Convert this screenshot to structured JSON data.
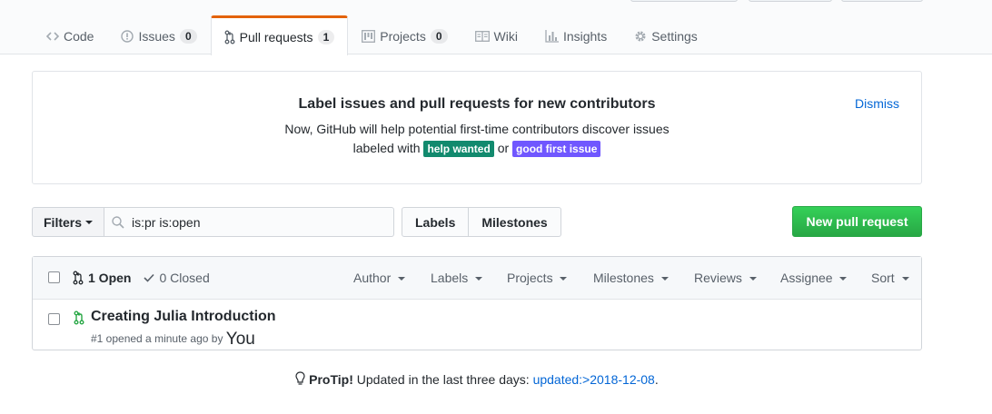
{
  "tabs": [
    {
      "label": "Code",
      "icon": "code-icon"
    },
    {
      "label": "Issues",
      "icon": "issue-opened-icon",
      "count": "0"
    },
    {
      "label": "Pull requests",
      "icon": "git-pull-request-icon",
      "count": "1",
      "selected": true
    },
    {
      "label": "Projects",
      "icon": "project-icon",
      "count": "0"
    },
    {
      "label": "Wiki",
      "icon": "book-icon"
    },
    {
      "label": "Insights",
      "icon": "graph-icon"
    },
    {
      "label": "Settings",
      "icon": "gear-icon"
    }
  ],
  "notice": {
    "title": "Label issues and pull requests for new contributors",
    "line1": "Now, GitHub will help potential first-time contributors discover issues",
    "line2_prefix": "labeled with",
    "label_help_wanted": "help wanted",
    "label_or": "or",
    "label_good_first_issue": "good first issue",
    "dismiss": "Dismiss",
    "help_wanted_color": "#128a6e",
    "good_first_issue_color": "#7057ff"
  },
  "filterbar": {
    "filters_label": "Filters",
    "search_value": "is:pr is:open",
    "labels_button": "Labels",
    "milestones_button": "Milestones",
    "new_pr_button": "New pull request"
  },
  "list_header": {
    "open_count": "1 Open",
    "closed_count": "0 Closed",
    "menus": [
      "Author",
      "Labels",
      "Projects",
      "Milestones",
      "Reviews",
      "Assignee",
      "Sort"
    ]
  },
  "pull_requests": [
    {
      "title": "Creating Julia Introduction",
      "meta": "#1 opened a minute ago by",
      "author": "You"
    }
  ],
  "protip": {
    "prefix": "ProTip!",
    "text": "Updated in the last three days:",
    "link": "updated:>2018-12-08",
    "suffix": "."
  }
}
